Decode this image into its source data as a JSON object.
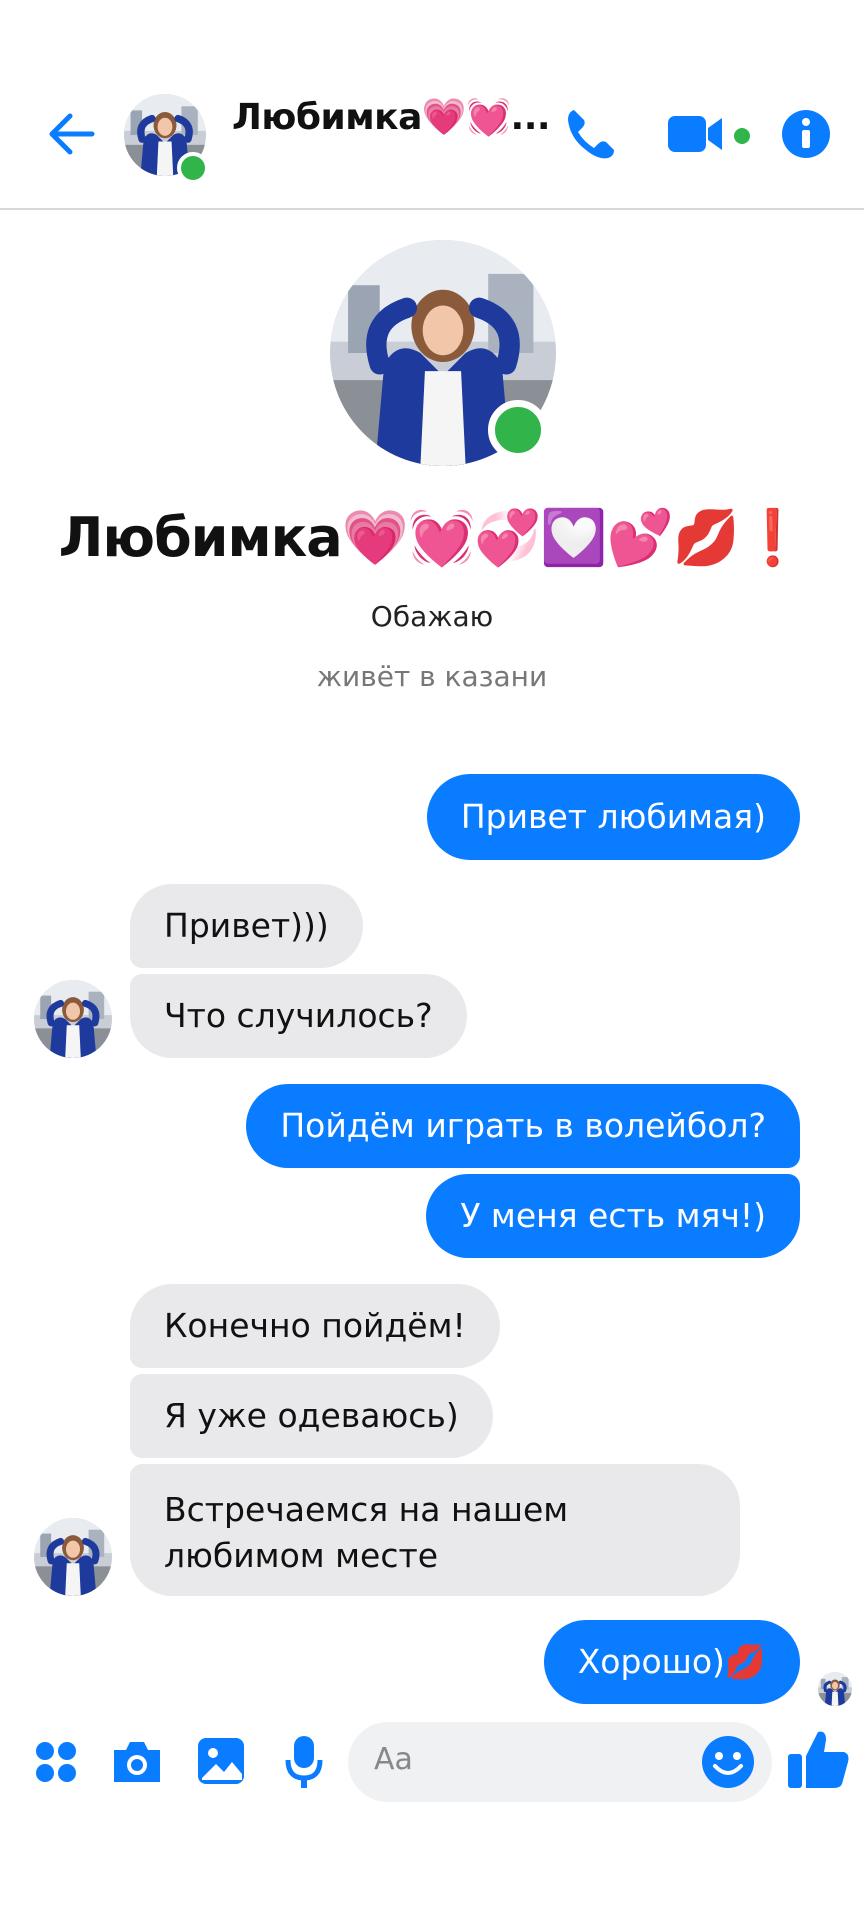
{
  "header": {
    "contact_name": "Любимка💗💓...",
    "status": "online"
  },
  "profile": {
    "name": "Любимка💗💓💞💟💕💋❗",
    "bio": "Обажаю",
    "location": "живёт в казани"
  },
  "messages": [
    {
      "direction": "out",
      "text": "Привет любимая)"
    },
    {
      "direction": "in",
      "text": "Привет)))"
    },
    {
      "direction": "in",
      "text": "Что случилось?"
    },
    {
      "direction": "out",
      "text": "Пойдём играть в волейбол?"
    },
    {
      "direction": "out",
      "text": "У меня есть мяч!)"
    },
    {
      "direction": "in",
      "text": "Конечно пойдём!"
    },
    {
      "direction": "in",
      "text": "Я уже одеваюсь)"
    },
    {
      "direction": "in",
      "text": "Встречаемся на нашем любимом месте"
    },
    {
      "direction": "out",
      "text": "Хорошо)💋"
    }
  ],
  "composer": {
    "placeholder": "Aa"
  },
  "colors": {
    "accent": "#0a7cff",
    "online": "#31b54a",
    "incoming_bubble": "#e9e9eb"
  },
  "icons": {
    "back": "arrow-left-icon",
    "call": "phone-icon",
    "video": "video-camera-icon",
    "info": "info-icon",
    "apps": "grid-dots-icon",
    "camera": "camera-icon",
    "gallery": "image-icon",
    "voice": "microphone-icon",
    "emoji": "smiley-icon",
    "like": "thumbs-up-icon"
  }
}
